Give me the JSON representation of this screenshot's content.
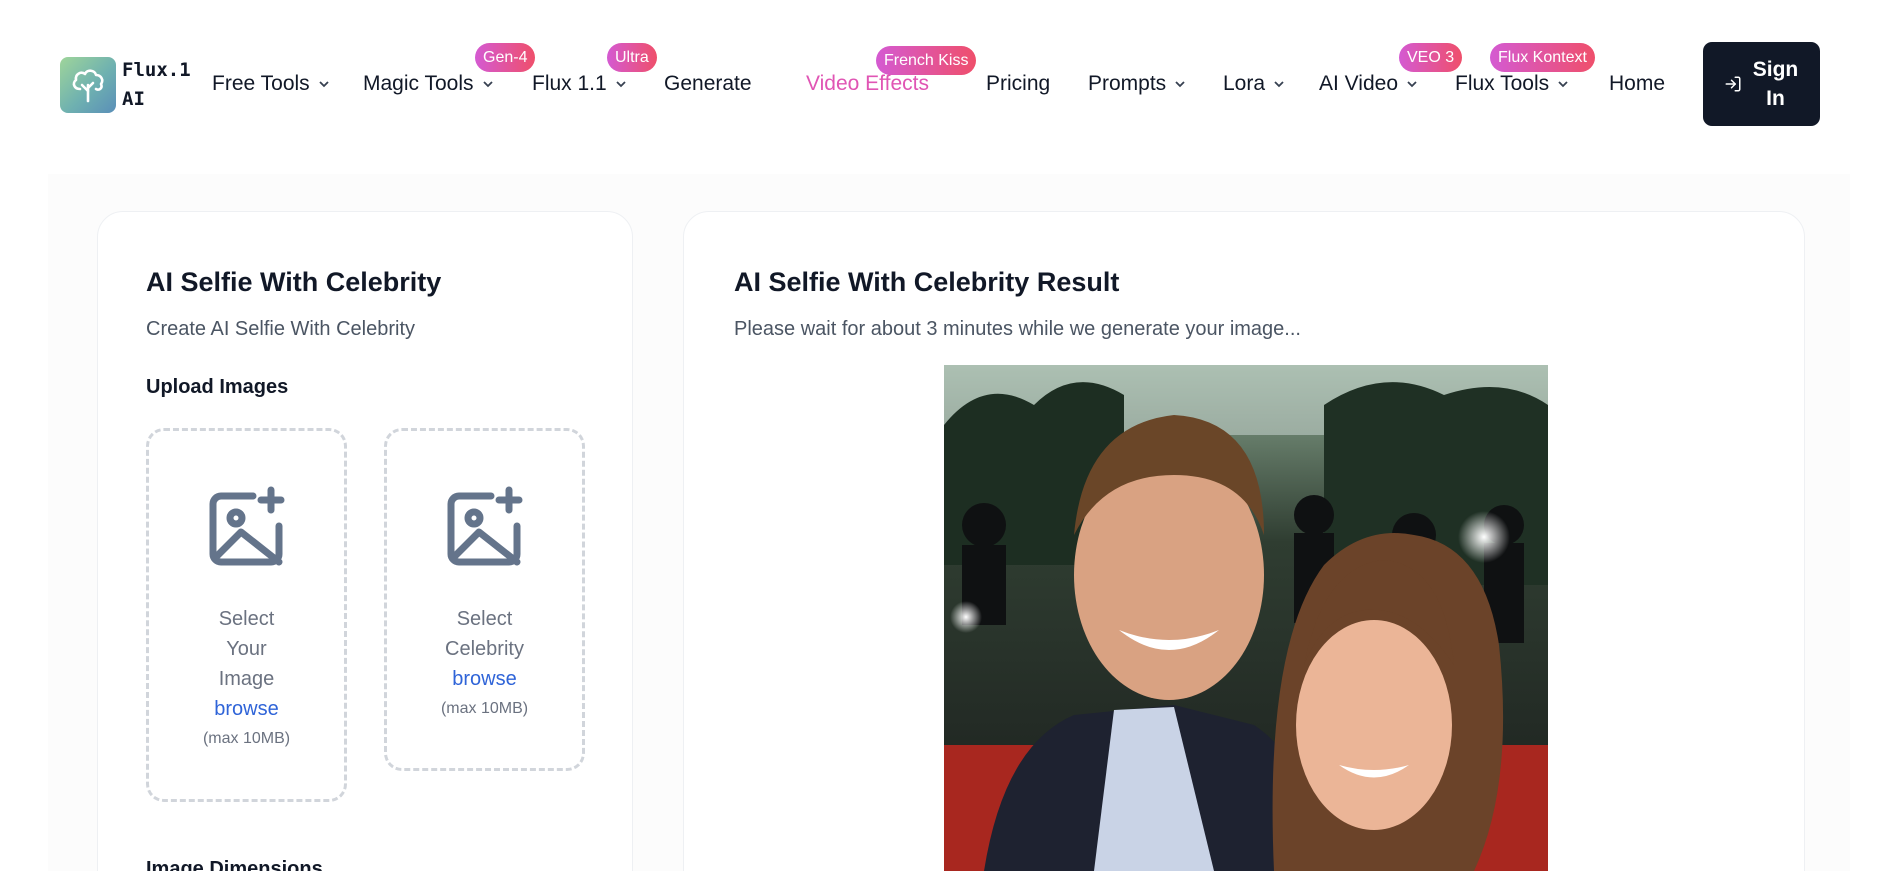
{
  "logo": {
    "line1": "Flux.1",
    "line2": "AI",
    "icon": "tree-logo-icon"
  },
  "nav": {
    "items": [
      {
        "label": "Free Tools",
        "dropdown": true
      },
      {
        "label": "Magic Tools",
        "dropdown": true,
        "badge": "Gen-4"
      },
      {
        "label": "Flux 1.1",
        "dropdown": true,
        "badge": "Ultra"
      },
      {
        "label": "Generate",
        "dropdown": false
      },
      {
        "label": "Video Effects",
        "dropdown": false,
        "badge": "French Kiss",
        "highlight": "#e055b4"
      },
      {
        "label": "Pricing",
        "dropdown": false
      },
      {
        "label": "Prompts",
        "dropdown": true
      },
      {
        "label": "Lora",
        "dropdown": true
      },
      {
        "label": "AI Video",
        "dropdown": true,
        "badge": "VEO 3"
      },
      {
        "label": "Flux Tools",
        "dropdown": true,
        "badge": "Flux Kontext"
      },
      {
        "label": "Home",
        "dropdown": false
      }
    ],
    "signin": {
      "line1": "Sign",
      "line2": "In",
      "icon": "sign-in-icon"
    }
  },
  "left_card": {
    "title": "AI Selfie With Celebrity",
    "subtitle": "Create AI Selfie With Celebrity",
    "upload_label": "Upload Images",
    "uploads": [
      {
        "lines": [
          "Select",
          "Your",
          "Image"
        ],
        "browse": "browse",
        "max": "(max 10MB)",
        "icon": "image-plus-icon"
      },
      {
        "lines": [
          "Select",
          "Celebrity"
        ],
        "browse": "browse",
        "max": "(max 10MB)",
        "icon": "image-plus-icon"
      }
    ],
    "dimensions_label": "Image Dimensions"
  },
  "right_card": {
    "title": "AI Selfie With Celebrity Result",
    "subtitle": "Please wait for about 3 minutes while we generate your image..."
  },
  "colors": {
    "accent_dark": "#111827",
    "badge_gradient_start": "#d45ad2",
    "badge_gradient_end": "#ef4f6b",
    "link": "#2f64d8",
    "highlight_nav": "#e055b4"
  }
}
